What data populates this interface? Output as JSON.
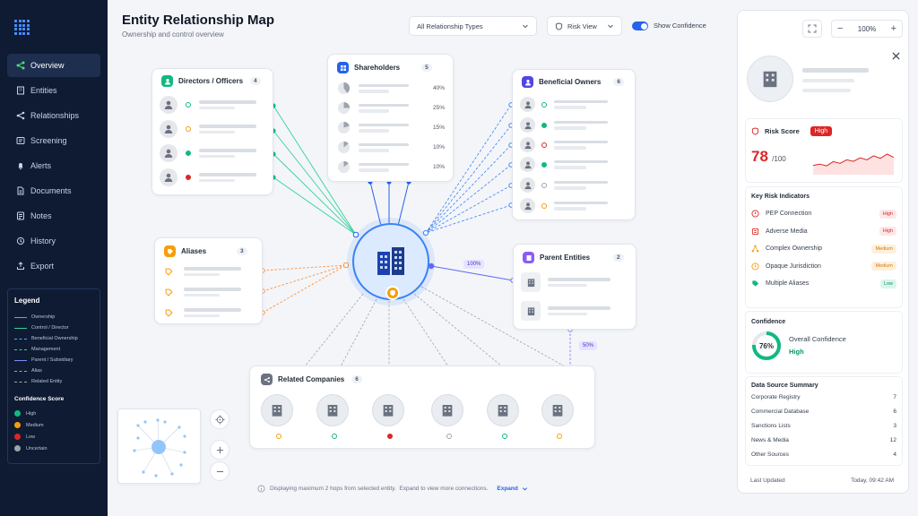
{
  "nav": {
    "items": [
      {
        "label": "Overview",
        "icon": "share-icon"
      },
      {
        "label": "Entities",
        "icon": "entities-icon"
      },
      {
        "label": "Relationships",
        "icon": "relationships-icon"
      },
      {
        "label": "Screening",
        "icon": "screening-icon"
      },
      {
        "label": "Alerts",
        "icon": "bell-icon"
      },
      {
        "label": "Documents",
        "icon": "document-icon"
      },
      {
        "label": "Notes",
        "icon": "notes-icon"
      },
      {
        "label": "History",
        "icon": "history-icon"
      },
      {
        "label": "Export",
        "icon": "export-icon"
      }
    ]
  },
  "legend": {
    "title": "Legend",
    "items": [
      {
        "label": "Ownership",
        "color": "#60a5fa",
        "style": "solid"
      },
      {
        "label": "Control / Director",
        "color": "#34d399",
        "style": "solid"
      },
      {
        "label": "Beneficial Ownership",
        "color": "#60a5fa",
        "style": "dashed"
      },
      {
        "label": "Management",
        "color": "#34d399",
        "style": "dashed"
      },
      {
        "label": "Parent / Subsidiary",
        "color": "#818cf8",
        "style": "solid"
      },
      {
        "label": "Alias",
        "color": "#fb923c",
        "style": "dashed"
      },
      {
        "label": "Related Entity",
        "color": "#9ca3af",
        "style": "dashed"
      }
    ],
    "confidence_title": "Confidence Score",
    "confidence": [
      {
        "label": "High",
        "color": "#10b981"
      },
      {
        "label": "Medium",
        "color": "#f59e0b"
      },
      {
        "label": "Low",
        "color": "#dc2626"
      },
      {
        "label": "Uncertain",
        "color": "#9ca3af"
      }
    ]
  },
  "header": {
    "title": "Entity Relationship Map",
    "subtitle": "Ownership and control overview",
    "filter_value": "All Relationship Types",
    "risk_view": "Risk View",
    "show_confidence": "Show Confidence"
  },
  "cards": {
    "directors": {
      "title": "Directors / Officers",
      "count": "4"
    },
    "shareholders": {
      "title": "Shareholders",
      "count": "5",
      "percents": [
        "40%",
        "25%",
        "15%",
        "10%",
        "10%"
      ]
    },
    "beneficial": {
      "title": "Beneficial Owners",
      "count": "6"
    },
    "aliases": {
      "title": "Aliases",
      "count": "3"
    },
    "parent": {
      "title": "Parent Entities",
      "count": "2"
    },
    "related": {
      "title": "Related Companies",
      "count": "6"
    }
  },
  "edges": {
    "parent_pct": "100%",
    "related_pct": "50%"
  },
  "footer": {
    "note": "Displaying maximum 2 hops from selected entity.  Expand to view more connections.",
    "expand": "Expand"
  },
  "panel": {
    "zoom": "100%",
    "risk_title": "Risk Score",
    "risk_level": "High",
    "risk_value": "78",
    "risk_max": "/100",
    "risk_trend": [
      0.3,
      0.35,
      0.28,
      0.45,
      0.38,
      0.52,
      0.46,
      0.6,
      0.52,
      0.68,
      0.58,
      0.75,
      0.62
    ],
    "kri_title": "Key Risk Indicators",
    "kri": [
      {
        "label": "PEP Connection",
        "level": "High",
        "color": "#dc2626",
        "bg": "#fde8e8"
      },
      {
        "label": "Adverse Media",
        "level": "High",
        "color": "#dc2626",
        "bg": "#fde8e8"
      },
      {
        "label": "Complex Ownership",
        "level": "Medium",
        "color": "#d97706",
        "bg": "#fdf1dc"
      },
      {
        "label": "Opaque Jurisdiction",
        "level": "Medium",
        "color": "#d97706",
        "bg": "#fdf1dc"
      },
      {
        "label": "Multiple Aliases",
        "level": "Low",
        "color": "#059669",
        "bg": "#dcf5ea"
      }
    ],
    "confidence_title": "Confidence",
    "confidence_pct": "76%",
    "confidence_value": 0.76,
    "confidence_label": "Overall Confidence",
    "confidence_level": "High",
    "ds_title": "Data Source Summary",
    "ds": [
      {
        "label": "Corporate Registry",
        "value": "7"
      },
      {
        "label": "Commercial Database",
        "value": "6"
      },
      {
        "label": "Sanctions Lists",
        "value": "3"
      },
      {
        "label": "News & Media",
        "value": "12"
      },
      {
        "label": "Other Sources",
        "value": "4"
      }
    ],
    "updated_label": "Last Updated",
    "updated_value": "Today, 09:42 AM"
  }
}
